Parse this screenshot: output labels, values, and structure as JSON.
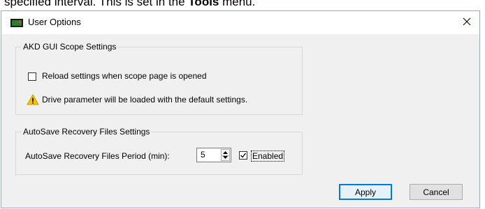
{
  "doc": {
    "text_before": "specified interval. This is set in the ",
    "text_bold": "Tools",
    "text_after": " menu."
  },
  "dialog": {
    "title": "User Options",
    "close_glyph": "✕",
    "scope_group": {
      "label": "AKD GUI Scope Settings",
      "reload_checkbox": {
        "label": "Reload settings when scope page is opened",
        "checked": false
      },
      "warning_text": "Drive parameter will be loaded with the default settings."
    },
    "autosave_group": {
      "label": "AutoSave Recovery Files Settings",
      "period_label": "AutoSave Recovery Files Period (min):",
      "period_value": "5",
      "enabled_checkbox": {
        "label": "Enabled",
        "checked": true
      }
    },
    "buttons": {
      "apply": "Apply",
      "cancel": "Cancel"
    }
  },
  "colors": {
    "dialog_bg": "#f0f0f0",
    "accent": "#0078d7",
    "warning": "#f5c400"
  },
  "icons": {
    "app": "app-window-icon",
    "close": "close-icon",
    "warning": "warning-icon",
    "check": "checkmark-icon",
    "spin_up": "chevron-up-icon",
    "spin_down": "chevron-down-icon"
  }
}
